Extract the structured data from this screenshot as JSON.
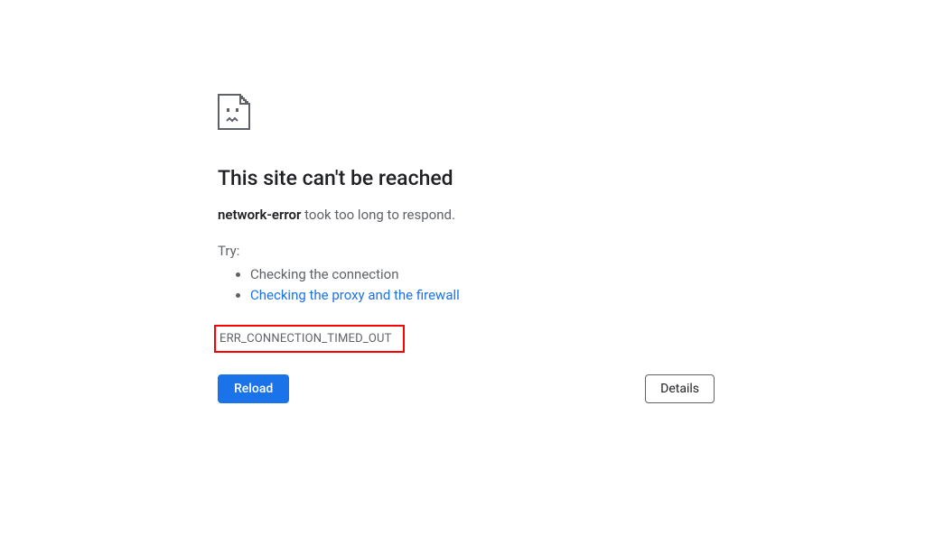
{
  "error": {
    "title": "This site can't be reached",
    "host": "network-error",
    "subtitle_suffix": " took too long to respond.",
    "try_label": "Try:",
    "suggestions": [
      {
        "text": "Checking the connection",
        "is_link": false
      },
      {
        "text": "Checking the proxy and the firewall",
        "is_link": true
      }
    ],
    "error_code": "ERR_CONNECTION_TIMED_OUT"
  },
  "buttons": {
    "reload": "Reload",
    "details": "Details"
  },
  "colors": {
    "link": "#1a73e8",
    "primary_button": "#1a73e8",
    "highlight_border": "#ff0000"
  }
}
